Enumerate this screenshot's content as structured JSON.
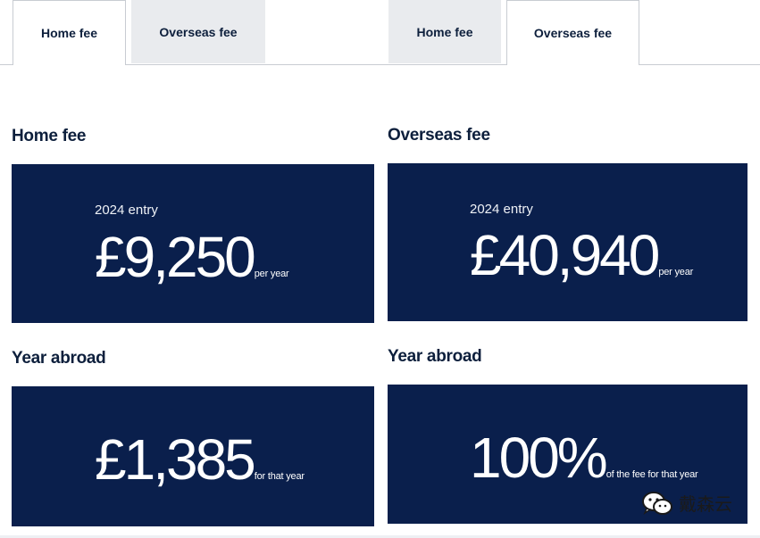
{
  "left": {
    "tabs": [
      {
        "label": "Home fee",
        "active": true
      },
      {
        "label": "Overseas fee",
        "active": false
      }
    ],
    "fee_heading": "Home fee",
    "fee_card": {
      "entry": "2024 entry",
      "amount": "£9,250",
      "unit": "per year"
    },
    "abroad_heading": "Year abroad",
    "abroad_card": {
      "amount": "£1,385",
      "unit": "for that year"
    }
  },
  "right": {
    "tabs": [
      {
        "label": "Home fee",
        "active": false
      },
      {
        "label": "Overseas fee",
        "active": true
      }
    ],
    "fee_heading": "Overseas fee",
    "fee_card": {
      "entry": "2024 entry",
      "amount": "£40,940",
      "unit": "per year"
    },
    "abroad_heading": "Year abroad",
    "abroad_card": {
      "amount": "100%",
      "unit": "of the fee for that year"
    }
  },
  "watermark": {
    "text": "戴森云",
    "icon": "wechat-icon"
  },
  "colors": {
    "card": "#0a1f4c",
    "text": "#0d1f3c",
    "tab_inactive": "#e9ebee"
  }
}
